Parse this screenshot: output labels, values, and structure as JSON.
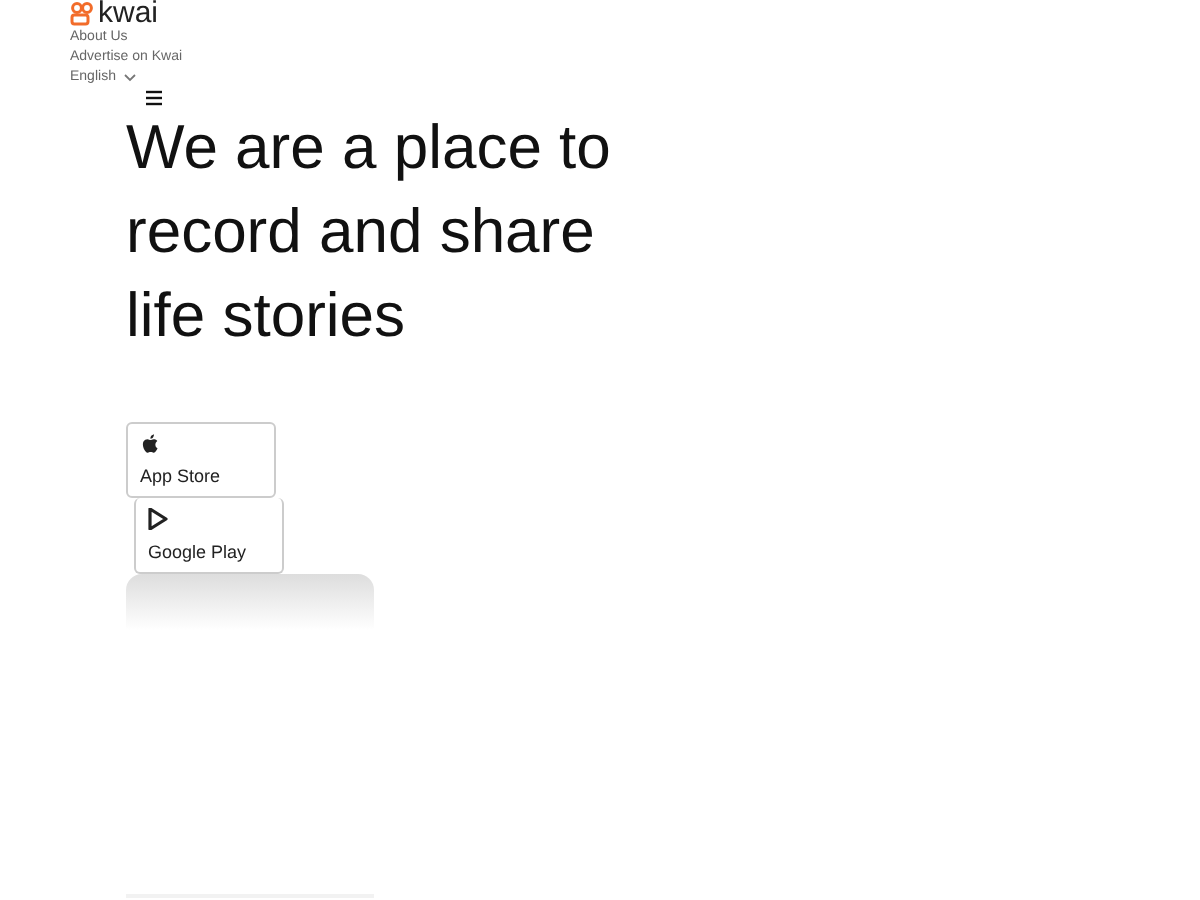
{
  "logo": {
    "text": "kwai"
  },
  "nav": [
    {
      "label": "About Us"
    },
    {
      "label": "Advertise on Kwai"
    }
  ],
  "language": {
    "label": "English"
  },
  "headline": "We are a place to record and share life stories",
  "store_buttons": [
    {
      "kind": "apple",
      "label": "App Store"
    },
    {
      "kind": "google",
      "label": "Google Play"
    }
  ]
}
